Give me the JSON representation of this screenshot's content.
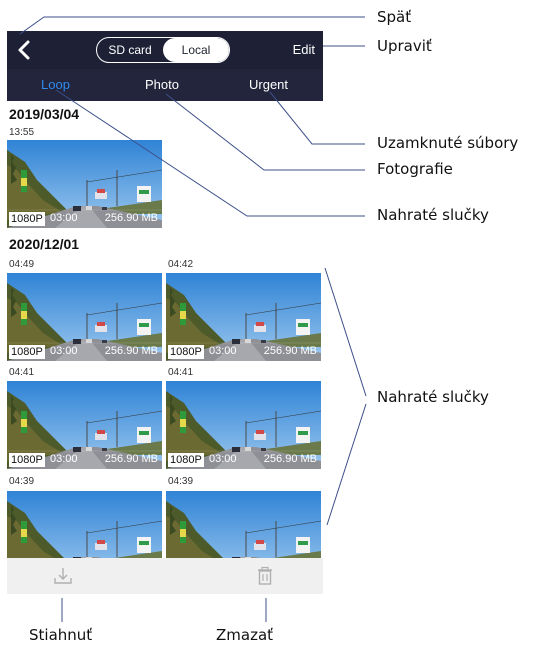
{
  "header": {
    "segment": {
      "sd_card": "SD card",
      "local": "Local",
      "selected": "Local"
    },
    "edit_label": "Edit"
  },
  "tabs": [
    {
      "label": "Loop",
      "active": true
    },
    {
      "label": "Photo",
      "active": false
    },
    {
      "label": "Urgent",
      "active": false
    }
  ],
  "groups": [
    {
      "date": "2019/03/04",
      "items": [
        {
          "time": "13:55",
          "resolution": "1080P",
          "duration": "03:00",
          "size": "256.90 MB"
        }
      ]
    },
    {
      "date": "2020/12/01",
      "items": [
        {
          "time": "04:49",
          "resolution": "1080P",
          "duration": "03:00",
          "size": "256.90 MB"
        },
        {
          "time": "04:42",
          "resolution": "1080P",
          "duration": "03:00",
          "size": "256.90 MB"
        },
        {
          "time": "04:41",
          "resolution": "1080P",
          "duration": "03:00",
          "size": "256.90 MB"
        },
        {
          "time": "04:41",
          "resolution": "1080P",
          "duration": "03:00",
          "size": "256.90 MB"
        },
        {
          "time": "04:39",
          "resolution": "",
          "duration": "",
          "size": ""
        },
        {
          "time": "04:39",
          "resolution": "",
          "duration": "",
          "size": ""
        }
      ]
    }
  ],
  "bottom_bar": {
    "download_icon": "download-icon",
    "delete_icon": "trash-icon"
  },
  "callouts": {
    "back": "Späť",
    "edit": "Upraviť",
    "urgent": "Uzamknuté súbory",
    "photo": "Fotografie",
    "loop": "Nahraté slučky",
    "thumbnails": "Nahraté slučky",
    "download": "Stiahnuť",
    "delete": "Zmazať"
  },
  "colors": {
    "topbar": "#1e2036",
    "tabbar": "#23253c",
    "active_tab": "#2f8bf0",
    "bottombar": "#f0f0f0"
  }
}
